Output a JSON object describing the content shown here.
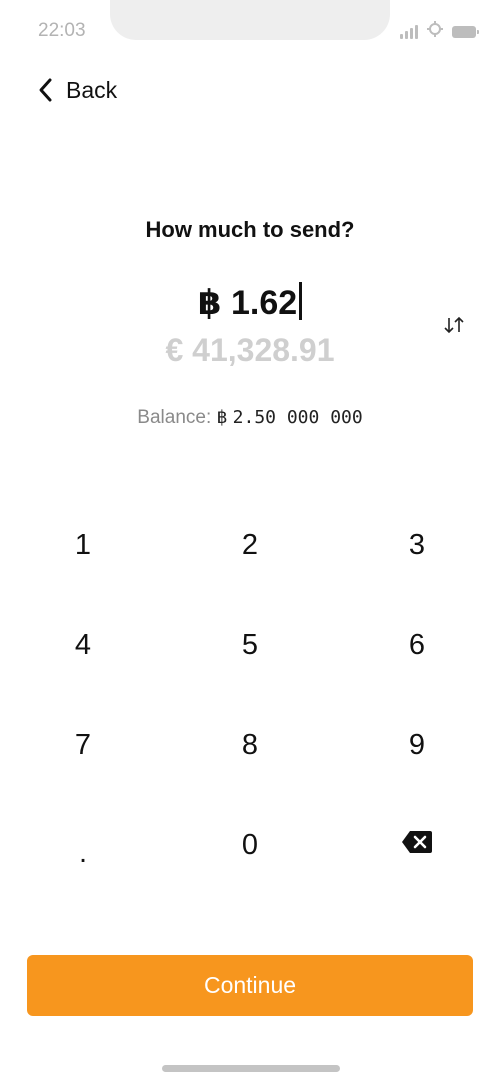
{
  "status_bar": {
    "time": "22:03",
    "icons": [
      "signal-icon",
      "bluetooth-icon",
      "battery-icon"
    ]
  },
  "nav": {
    "back_label": "Back",
    "back_icon": "chevron-left-icon"
  },
  "heading": "How much to send?",
  "amount": {
    "currency_symbol": "฿",
    "value": "1.62",
    "fiat_display": "€ 41,328.91"
  },
  "swap_icon": "swap-arrows-icon",
  "balance": {
    "label": "Balance:",
    "currency_symbol": "฿",
    "value": "2.50 000 000"
  },
  "keypad": {
    "keys": [
      "1",
      "2",
      "3",
      "4",
      "5",
      "6",
      "7",
      "8",
      "9",
      ".",
      "0"
    ],
    "backspace_icon": "backspace-icon"
  },
  "continue_label": "Continue",
  "colors": {
    "accent": "#f7961e",
    "muted_text": "#cfcfcf",
    "secondary_text": "#8a8a8a"
  }
}
